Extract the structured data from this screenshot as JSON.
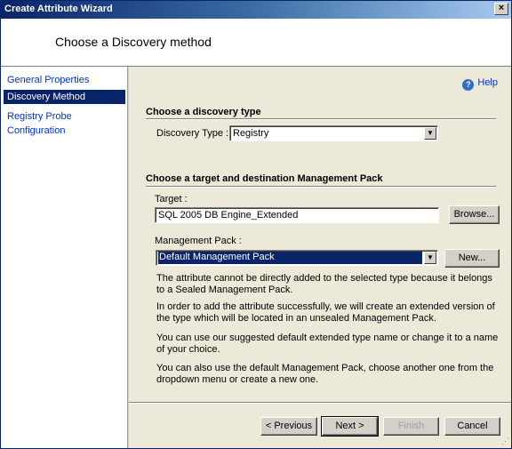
{
  "window": {
    "title": "Create Attribute Wizard",
    "close_glyph": "×"
  },
  "header": {
    "heading": "Choose a Discovery method"
  },
  "nav": {
    "items": [
      {
        "label": "General Properties"
      },
      {
        "label": "Discovery Method"
      },
      {
        "label": "Registry Probe Configuration"
      }
    ]
  },
  "help": {
    "label": "Help",
    "icon": "help-icon"
  },
  "discovery": {
    "section_title": "Choose a discovery type",
    "type_label": "Discovery Type :",
    "type_value": "Registry"
  },
  "target_section": {
    "section_title": "Choose a target and destination Management Pack",
    "target_label": "Target :",
    "target_value": "SQL 2005 DB Engine_Extended",
    "browse_label": "Browse...",
    "mp_label": "Management Pack :",
    "mp_value": "Default Management Pack",
    "new_label": "New..."
  },
  "info": {
    "p1": "The attribute cannot be directly added to the selected type because it belongs to a Sealed Management Pack.",
    "p2": "In order to add the attribute successfully, we will create an extended version of the type which will be located in an unsealed Management Pack.",
    "p3": "You can use our suggested default extended type name or change it to a name of your choice.",
    "p4": "You can also use the default Management Pack, choose another one from the dropdown menu or create a new one."
  },
  "buttons": {
    "previous": "< Previous",
    "next": "Next >",
    "finish": "Finish",
    "cancel": "Cancel"
  }
}
